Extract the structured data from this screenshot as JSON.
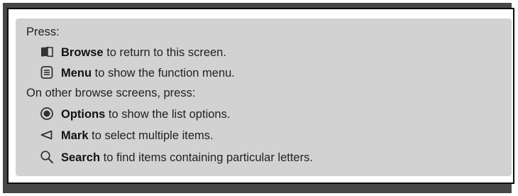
{
  "help": {
    "press_intro": "Press:",
    "items": [
      {
        "icon": "browse-book-icon",
        "key": "Browse",
        "text": " to return to this screen."
      },
      {
        "icon": "menu-icon",
        "key": "Menu",
        "text": " to show the function menu."
      }
    ],
    "other_intro": "On other browse screens, press:",
    "other_items": [
      {
        "icon": "options-radio-icon",
        "key": "Options",
        "text": " to show the list options."
      },
      {
        "icon": "mark-triangle-icon",
        "key": "Mark",
        "text": " to select multiple items."
      },
      {
        "icon": "search-magnifier-icon",
        "key": "Search",
        "text": " to find items containing particular letters."
      }
    ]
  },
  "colors": {
    "backdrop": "#474747",
    "panel_fill": "#d2d2d2",
    "text": "#222222"
  }
}
